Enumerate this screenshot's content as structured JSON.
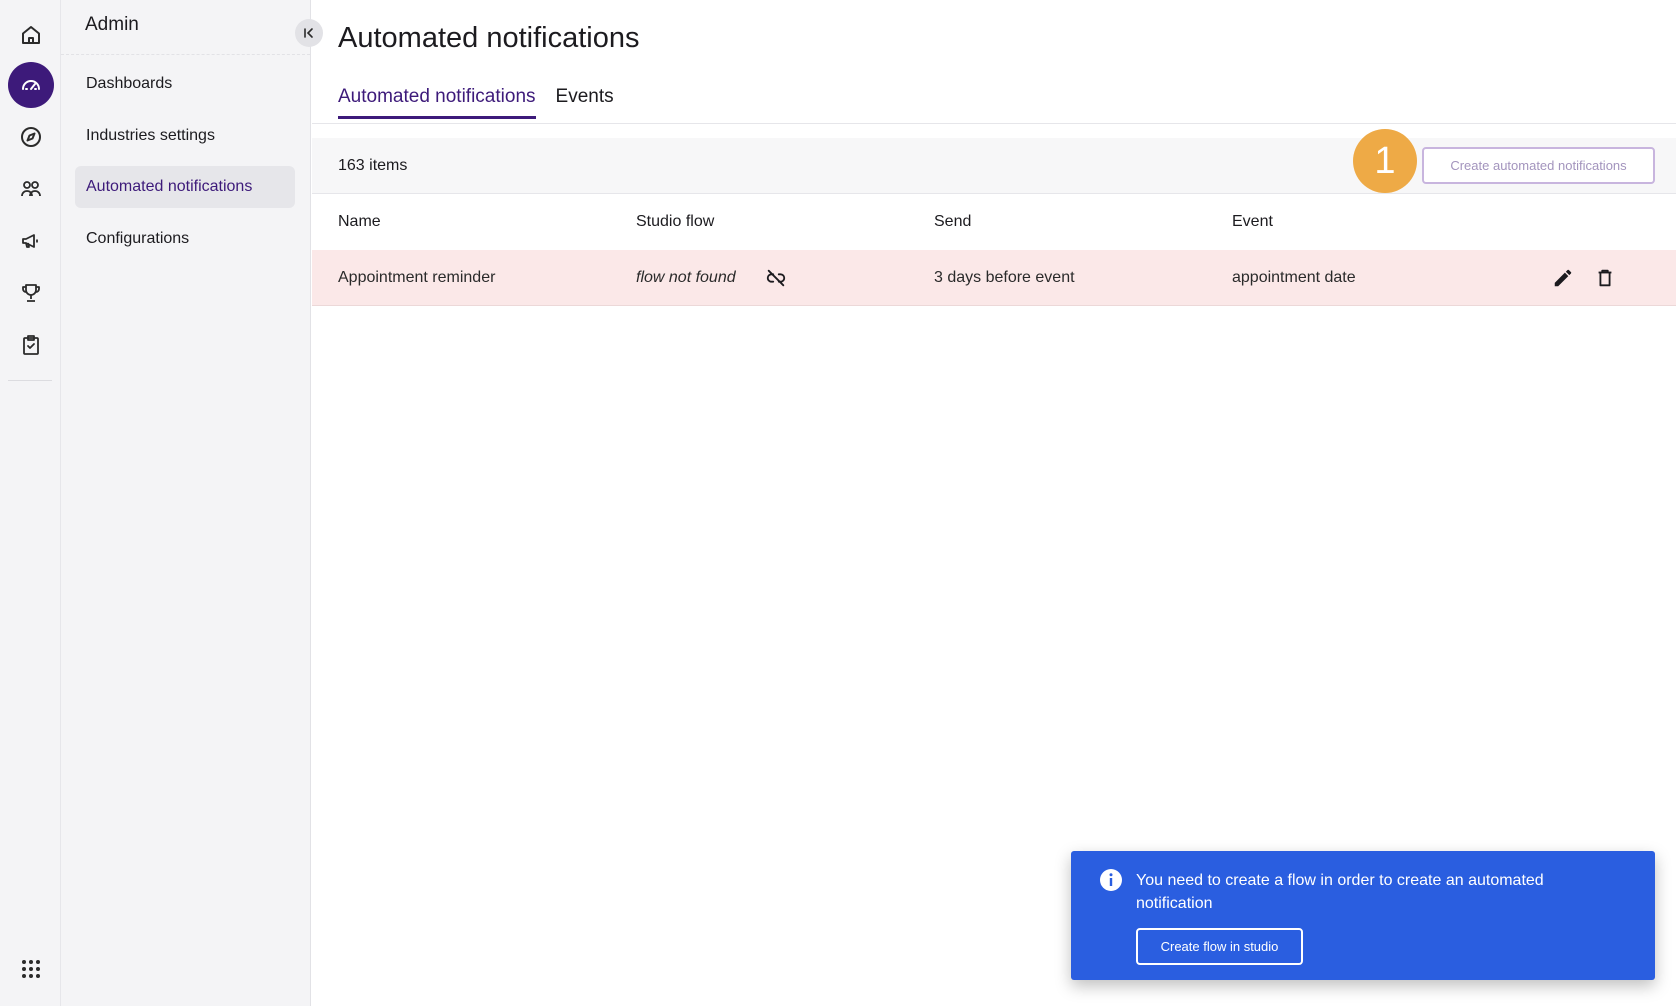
{
  "rail": {
    "items": [
      {
        "icon": "home-icon"
      },
      {
        "icon": "dashboard-gauge-icon",
        "active": true
      },
      {
        "icon": "compass-icon"
      },
      {
        "icon": "users-icon"
      },
      {
        "icon": "megaphone-icon"
      },
      {
        "icon": "trophy-icon"
      },
      {
        "icon": "clipboard-check-icon"
      }
    ],
    "apps_icon": "apps-grid-icon",
    "active_color": "#3d1a7a"
  },
  "sidebar": {
    "title": "Admin",
    "items": [
      {
        "label": "Dashboards"
      },
      {
        "label": "Industries settings"
      },
      {
        "label": "Automated notifications",
        "active": true
      },
      {
        "label": "Configurations"
      }
    ]
  },
  "main": {
    "title": "Automated notifications",
    "tabs": [
      {
        "label": "Automated notifications",
        "active": true
      },
      {
        "label": "Events"
      }
    ],
    "items_count": "163 items",
    "step_badge": "1",
    "create_button": "Create automated notifications",
    "columns": [
      "Name",
      "Studio flow",
      "Send",
      "Event"
    ],
    "rows": [
      {
        "name": "Appointment reminder",
        "studio_flow": "flow not found",
        "send": "3 days before event",
        "event": "appointment date"
      }
    ]
  },
  "toast": {
    "message": "You need to create a flow in order to create an automated notification",
    "button": "Create flow in studio",
    "color": "#2a5ee0"
  },
  "colors": {
    "accent": "#3d1a7a",
    "row_error_bg": "#fbe8e8",
    "badge": "#eeaa46"
  }
}
